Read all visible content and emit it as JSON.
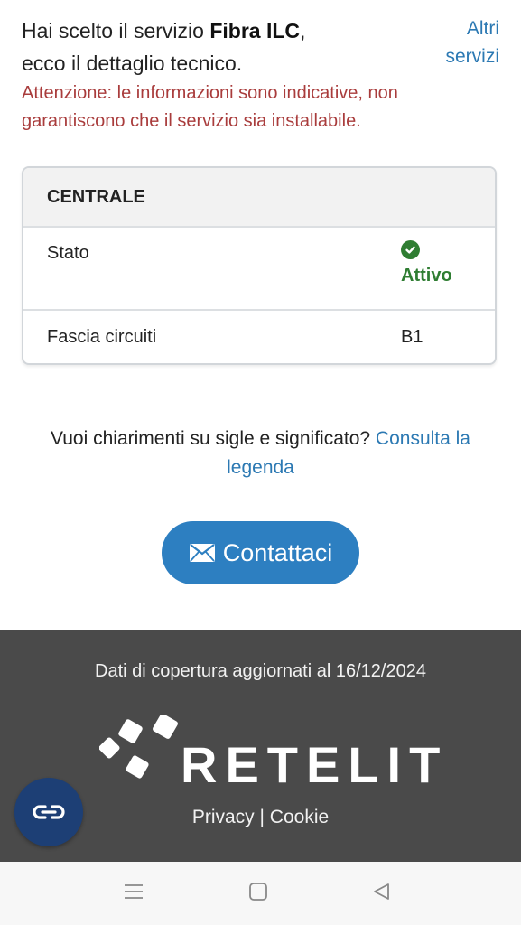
{
  "intro": {
    "prefix": "Hai scelto il servizio ",
    "service": "Fibra ILC",
    "suffix": ",",
    "line2": "ecco il dettaglio tecnico."
  },
  "other_services": {
    "line1": "Altri",
    "line2": "servizi"
  },
  "warning": "Attenzione: le informazioni sono indicative, non garantiscono che il servizio sia installabile.",
  "card": {
    "title": "CENTRALE",
    "rows": [
      {
        "label": "Stato",
        "value": "Attivo",
        "icon": "check-circle-icon"
      },
      {
        "label": "Fascia circuiti",
        "value": "B1"
      }
    ]
  },
  "legend": {
    "text": "Vuoi chiarimenti su sigle e significato? ",
    "link_line1": "Consulta la",
    "link_line2": "legenda"
  },
  "contact_button": {
    "label": "Contattaci",
    "icon": "envelope-icon"
  },
  "footer": {
    "updated": "Dati di copertura aggiornati al 16/12/2024",
    "brand": "RETELIT",
    "privacy": "Privacy",
    "separator": " | ",
    "cookie": "Cookie"
  },
  "colors": {
    "link": "#2c79b3",
    "warning": "#a93c3c",
    "status_active": "#2f7d32",
    "button": "#2d7fc1",
    "footer_bg": "#4a4a4a",
    "chat_bg": "#1d3f75"
  }
}
